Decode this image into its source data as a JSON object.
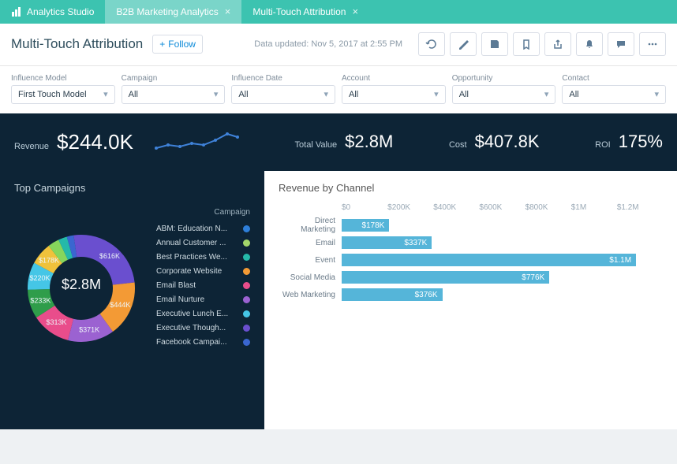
{
  "tabs": {
    "brand": "Analytics Studio",
    "items": [
      {
        "label": "B2B Marketing Analytics",
        "active": true
      },
      {
        "label": "Multi-Touch Attribution",
        "active": false
      }
    ]
  },
  "header": {
    "title": "Multi-Touch Attribution",
    "follow_label": "Follow",
    "updated": "Data updated: Nov 5, 2017 at 2:55 PM"
  },
  "filters": [
    {
      "label": "Influence Model",
      "value": "First Touch Model"
    },
    {
      "label": "Campaign",
      "value": "All"
    },
    {
      "label": "Influence Date",
      "value": "All"
    },
    {
      "label": "Account",
      "value": "All"
    },
    {
      "label": "Opportunity",
      "value": "All"
    },
    {
      "label": "Contact",
      "value": "All"
    }
  ],
  "metrics": {
    "revenue_label": "Revenue",
    "revenue_value": "$244.0K",
    "total_label": "Total Value",
    "total_value": "$2.8M",
    "cost_label": "Cost",
    "cost_value": "$407.8K",
    "roi_label": "ROI",
    "roi_value": "175%"
  },
  "top_campaigns": {
    "title": "Top Campaigns",
    "center": "$2.8M",
    "legend_title": "Campaign",
    "legend": [
      {
        "label": "ABM: Education N...",
        "color": "#2e7fd9"
      },
      {
        "label": "Annual Customer ...",
        "color": "#a2d66a"
      },
      {
        "label": "Best Practices We...",
        "color": "#25b9a9"
      },
      {
        "label": "Corporate Website",
        "color": "#f39a35"
      },
      {
        "label": "Email Blast",
        "color": "#e94d8b"
      },
      {
        "label": "Email Nurture",
        "color": "#9b62d1"
      },
      {
        "label": "Executive Lunch E...",
        "color": "#45c6e6"
      },
      {
        "label": "Executive Though...",
        "color": "#6a4fcf"
      },
      {
        "label": "Facebook Campai...",
        "color": "#3a66d0"
      }
    ]
  },
  "revenue_channel": {
    "title": "Revenue by Channel"
  },
  "chart_data": [
    {
      "type": "pie",
      "title": "Top Campaigns",
      "center_label": "$2.8M",
      "slices": [
        {
          "label": "$616K",
          "value_k": 616,
          "color": "#6a4fcf"
        },
        {
          "label": "$444K",
          "value_k": 444,
          "color": "#f39a35"
        },
        {
          "label": "$371K",
          "value_k": 371,
          "color": "#9b62d1"
        },
        {
          "label": "$313K",
          "value_k": 313,
          "color": "#e94d8b"
        },
        {
          "label": "$233K",
          "value_k": 233,
          "color": "#2f9d4a"
        },
        {
          "label": "$220K",
          "value_k": 220,
          "color": "#45c6e6"
        },
        {
          "label": "$178K",
          "value_k": 178,
          "color": "#f0c23b"
        },
        {
          "label": "",
          "value_k": 90,
          "color": "#86d65c"
        },
        {
          "label": "",
          "value_k": 70,
          "color": "#25b9a9"
        },
        {
          "label": "",
          "value_k": 55,
          "color": "#3a66d0"
        },
        {
          "label": "",
          "value_k": 60,
          "color": "#6a4fcf"
        }
      ]
    },
    {
      "type": "bar",
      "orientation": "horizontal",
      "title": "Revenue by Channel",
      "xlabel": "",
      "ylabel": "",
      "xlim": [
        0,
        1200000
      ],
      "ticks": [
        "$0",
        "$200K",
        "$400K",
        "$600K",
        "$800K",
        "$1M",
        "$1.2M"
      ],
      "categories": [
        "Direct Marketing",
        "Email",
        "Event",
        "Social Media",
        "Web Marketing"
      ],
      "values_usd": [
        178000,
        337000,
        1100000,
        776000,
        376000
      ],
      "value_labels": [
        "$178K",
        "$337K",
        "$1.1M",
        "$776K",
        "$376K"
      ],
      "bar_color": "#55b5d9"
    }
  ]
}
